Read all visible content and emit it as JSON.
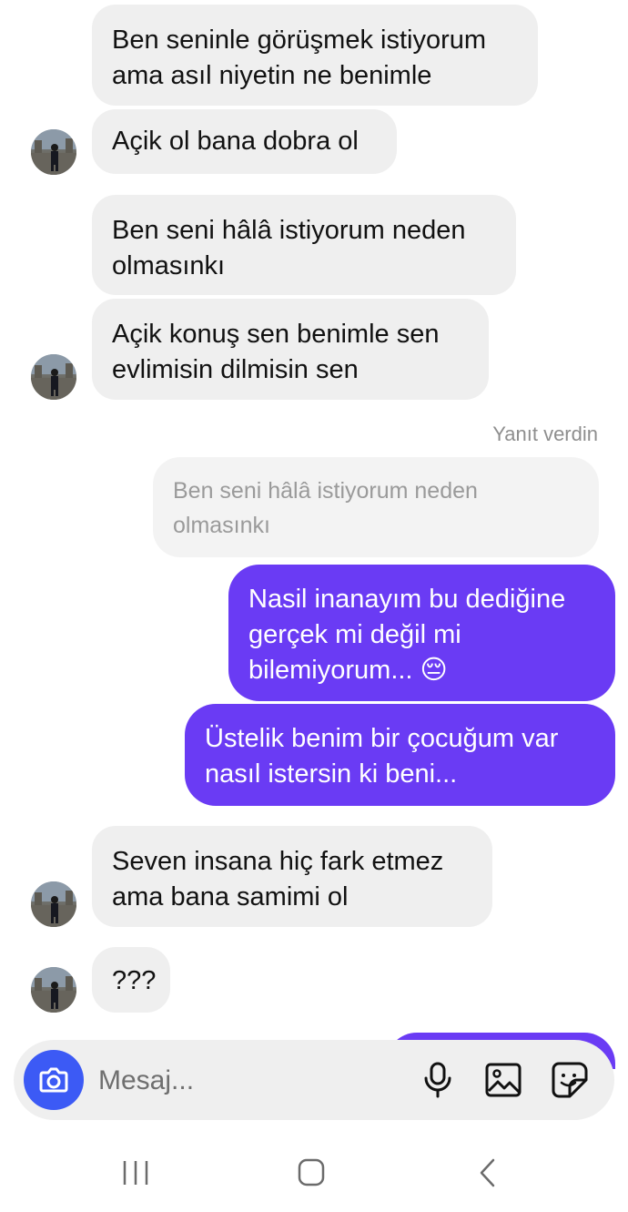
{
  "messages": [
    {
      "sender": "them",
      "text": "Ben seninle görüşmek istiyorum\nama asıl niyetin ne benimle"
    },
    {
      "sender": "them",
      "text": "Açik ol bana dobra ol"
    },
    {
      "sender": "them",
      "text": "Ben seni hâlâ istiyorum neden\nolmasınkı"
    },
    {
      "sender": "them",
      "text": "Açik konuş sen benimle sen\nevlimisin dilmisin sen"
    },
    {
      "sender": "me",
      "text": "Nasil inanayım bu dediğine\ngerçek mi değil mi\nbilemiyorum... 😔"
    },
    {
      "sender": "me",
      "text": "Üstelik benim bir çocuğum var\nnasıl istersin ki beni..."
    },
    {
      "sender": "them",
      "text": "Seven insana hiç fark etmez\nama bana samimi ol"
    },
    {
      "sender": "them",
      "text": "???"
    }
  ],
  "reply": {
    "label": "Yanıt verdin",
    "quoted_text": "Ben seni hâlâ istiyorum neden\nolmasınkı"
  },
  "composer": {
    "placeholder": "Mesaj...",
    "icons": [
      "camera-icon",
      "microphone-icon",
      "image-icon",
      "sticker-icon"
    ]
  },
  "nav": {
    "icons": [
      "recent-apps-icon",
      "home-icon",
      "back-icon"
    ]
  },
  "colors": {
    "outgoing_bubble": "#6a3bf4",
    "incoming_bubble": "#efefef",
    "camera_button": "#3c5af5"
  }
}
